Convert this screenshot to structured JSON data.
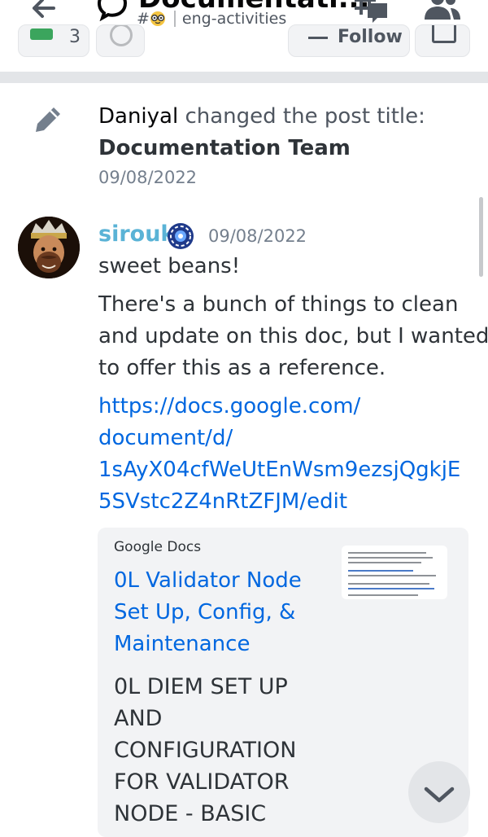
{
  "header": {
    "thread_title": "Documentati...",
    "channel_hash": "#",
    "channel_name": "eng-activities"
  },
  "actions": {
    "tags_count": "3",
    "follow_label": "Follow"
  },
  "system_message": {
    "author": "Daniyal",
    "action": "changed the post title:",
    "new_title": "Documentation Team",
    "date": "09/08/2022"
  },
  "message": {
    "author": "sirouk",
    "date": "09/08/2022",
    "line1": "sweet beans!",
    "para_lines": [
      "There's a bunch of things to clean",
      "and update on this doc, but I wanted",
      "to offer this as a reference."
    ],
    "link_lines": [
      "https://docs.google.com/",
      "document/d/",
      "1sAyX04cfWeUtEnWsm9ezsjQgkjE",
      "5SVstc2Z4nRtZFJM/edit"
    ]
  },
  "embed": {
    "provider": "Google Docs",
    "title_lines": [
      "0L Validator Node",
      "Set Up, Config, &",
      "Maintenance"
    ],
    "desc_lines": [
      "0L DIEM SET UP",
      "AND",
      "CONFIGURATION",
      "FOR VALIDATOR",
      "NODE - BASIC"
    ]
  },
  "colors": {
    "author": "#5ab3d6",
    "link": "#0067e0",
    "text": "#2e3338",
    "muted": "#747f8d"
  }
}
